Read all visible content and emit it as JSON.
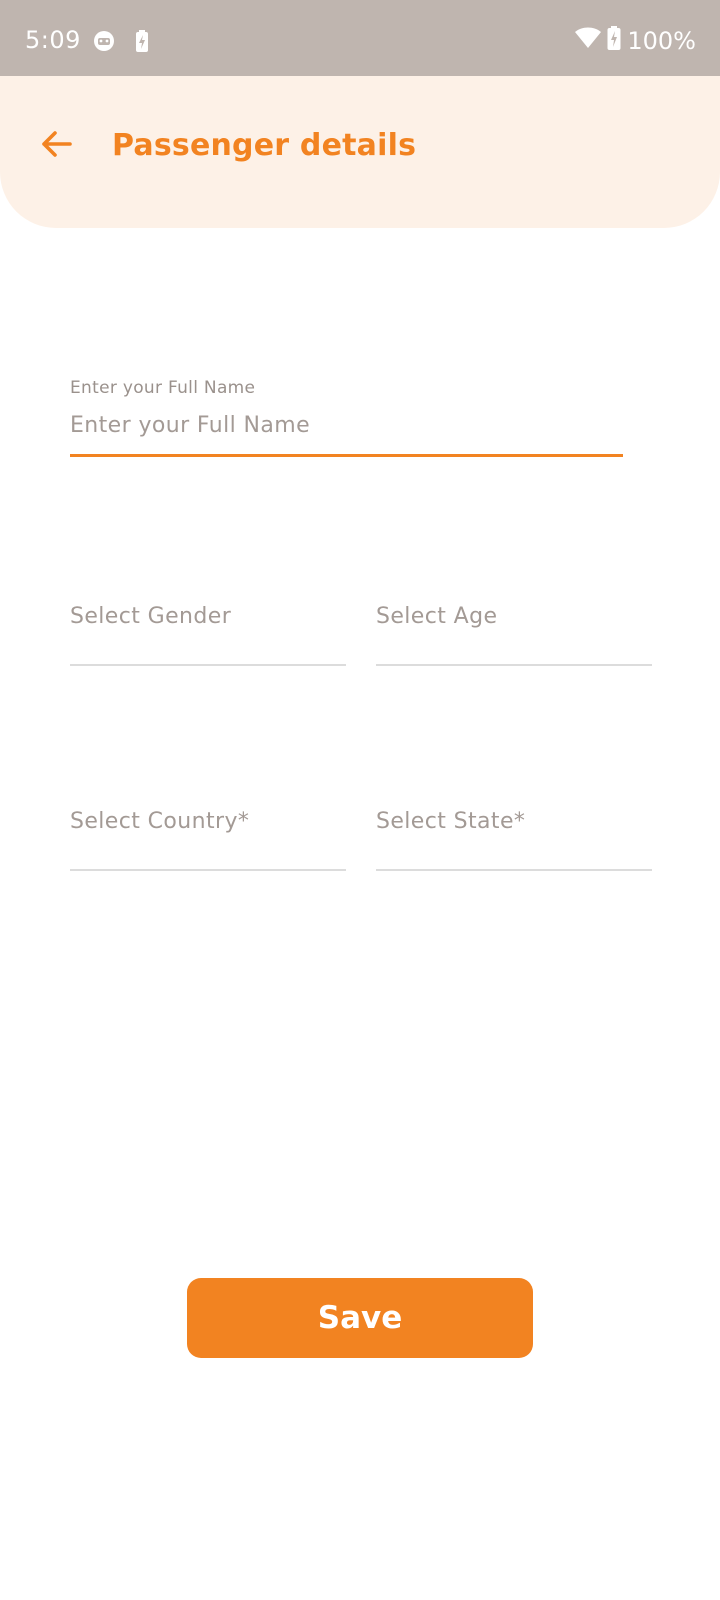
{
  "status_bar": {
    "time": "5:09",
    "battery": "100%",
    "background": "#bfb5af",
    "icons": [
      "notification-bug-icon",
      "battery-saver-icon",
      "wifi-icon",
      "battery-charging-icon"
    ]
  },
  "header": {
    "title": "Passenger details",
    "back_icon": "arrow-left-icon",
    "background": "#fdf1e7",
    "accent": "#f28321"
  },
  "form": {
    "full_name": {
      "label": "Enter your Full Name",
      "placeholder": "Enter your Full Name",
      "value": ""
    },
    "gender": {
      "placeholder": "Select Gender"
    },
    "age": {
      "placeholder": "Select Age"
    },
    "country": {
      "placeholder": "Select Country*"
    },
    "state": {
      "placeholder": "Select State*"
    }
  },
  "actions": {
    "save_label": "Save"
  }
}
